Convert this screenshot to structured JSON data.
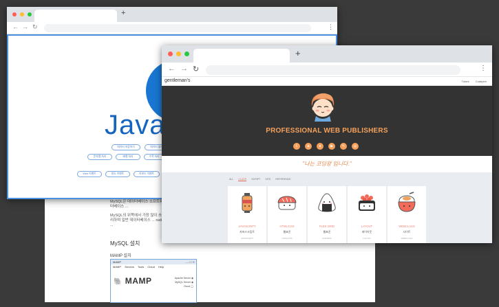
{
  "back_browser": {
    "logo_text": "Java",
    "pills_row1": [
      "데이터 저장하기",
      "데이터 불러오기"
    ],
    "pills_row2": [
      "문자열 처리",
      "배열 처리",
      "수학 처리"
    ],
    "pills_row3": [
      "Web 이벤트",
      "윈도 이벤트",
      "키보드 이벤트"
    ]
  },
  "doc": {
    "para1": "MySQL은 데이터베이스 소프트웨어 ... 가능을 모두 포함해서 데이터베이스 ...",
    "para2": "MySQL의 위쪽에서 가장 많이 쓰이는 오픈 ... 원된 연동과 처리 편리하며 일반 데이터베이스 ... nativer, 워드프레스, 그누보드 등 웹 ...",
    "heading": "MySQL 설치",
    "sub": "MAMP 설치",
    "mamp": {
      "title": "MAMP",
      "menu": [
        "MAMP",
        "Servers",
        "Tools",
        "Cloud",
        "Help"
      ],
      "logo": "MAMP",
      "servers": [
        "Apache Server",
        "MySQL Server",
        "Cloud"
      ]
    }
  },
  "front_browser": {
    "site_logo": "gentleman's",
    "nav_links": [
      "Tutors",
      "Codepen"
    ],
    "hero_title": "PROFESSIONAL WEB PUBLISHERS",
    "socials": [
      "twitter-icon",
      "codepen-icon",
      "github-icon",
      "youtube-icon",
      "blog-icon",
      "instagram-icon"
    ],
    "quote": "\"나는 코딩왕 입니다.\"",
    "filters": [
      "ALL",
      "CLASS",
      "SCRIPT",
      "SITE",
      "REFERENCE"
    ],
    "active_filter": "CLASS",
    "cards": [
      {
        "title": "JAVASCRIPT",
        "subtitle": "자바스크립트",
        "tag": "JAVASCRIPT",
        "icon": "lantern-sushi-icon"
      },
      {
        "title": "HTML/CSS",
        "subtitle": "웹표준",
        "tag": "HTML/CSS",
        "icon": "salmon-sushi-icon"
      },
      {
        "title": "FLEX GRID",
        "subtitle": "웹표준",
        "tag": "FLEXBOX",
        "icon": "onigiri-icon"
      },
      {
        "title": "LAYOUT",
        "subtitle": "레이아웃",
        "tag": "LAYOUT",
        "icon": "ikura-sushi-icon"
      },
      {
        "title": "WEBCLASS",
        "subtitle": "사이트",
        "tag": "WEBCLASS",
        "icon": "rice-bowl-icon"
      }
    ]
  },
  "colors": {
    "accent": "#f5a15b",
    "hero_bg": "#333333",
    "js_blue": "#1976d2",
    "page_bg": "#3a3a3a"
  }
}
